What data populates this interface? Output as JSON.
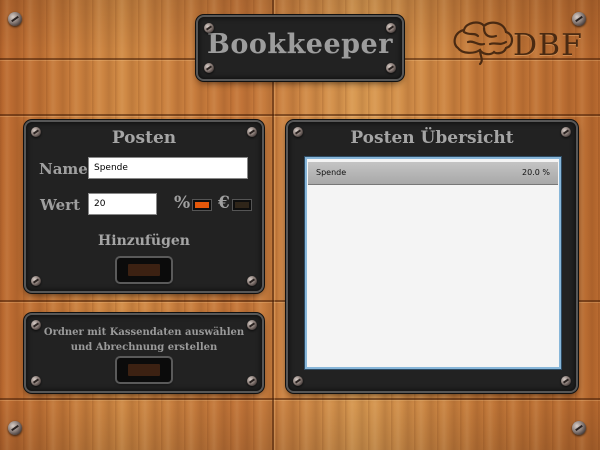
{
  "app": {
    "title": "Bookkeeper",
    "logo_text": "DBF"
  },
  "posten": {
    "title": "Posten",
    "name_label": "Name",
    "name_value": "Spende",
    "wert_label": "Wert",
    "wert_value": "20",
    "percent_symbol": "%",
    "euro_symbol": "€",
    "percent_active": true,
    "euro_active": false,
    "add_label": "Hinzufügen"
  },
  "ordner": {
    "label": "Ordner mit Kassendaten auswählen und Abrechnung erstellen"
  },
  "uebersicht": {
    "title": "Posten Übersicht",
    "items": [
      {
        "name": "Spende",
        "value": "20.0 %"
      }
    ]
  },
  "colors": {
    "accent_on": "#e5580a",
    "list_border": "#87b6d9",
    "label_gray": "#a0a0a0"
  }
}
